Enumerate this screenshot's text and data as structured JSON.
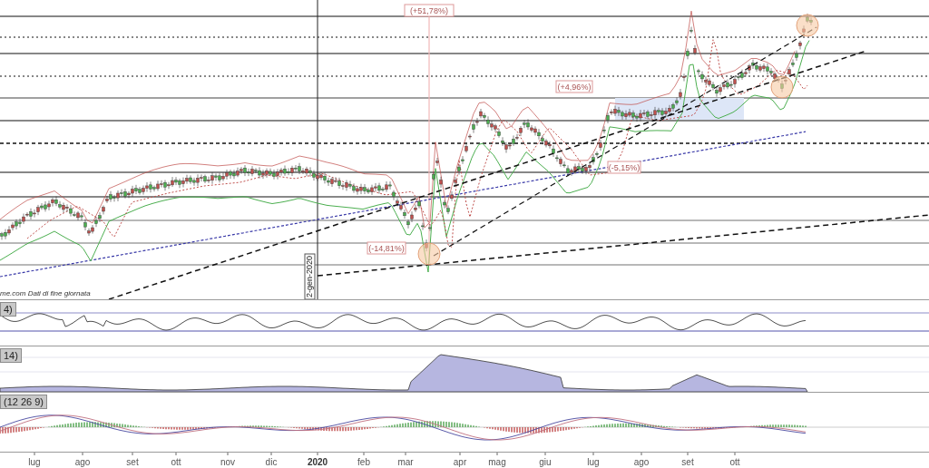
{
  "main_chart": {
    "annotations": [
      "(+51,78%)",
      "(+4,96%)",
      "(-5,15%)",
      "(-14,81%)"
    ],
    "date_marker": "2-gen-2020",
    "source_note": "me.com Dati di fine giornata"
  },
  "panels": [
    {
      "label": "4)",
      "kind": "oscillator"
    },
    {
      "label": "14)",
      "kind": "area"
    },
    {
      "label": "(12 26 9)",
      "kind": "histogram"
    }
  ],
  "x_axis": [
    {
      "text": "lug",
      "kind": "month"
    },
    {
      "text": "ago",
      "kind": "month"
    },
    {
      "text": "set",
      "kind": "month"
    },
    {
      "text": "ott",
      "kind": "month"
    },
    {
      "text": "nov",
      "kind": "month"
    },
    {
      "text": "dic",
      "kind": "month"
    },
    {
      "text": "2020",
      "kind": "year"
    },
    {
      "text": "feb",
      "kind": "month"
    },
    {
      "text": "mar",
      "kind": "month"
    },
    {
      "text": "apr",
      "kind": "month"
    },
    {
      "text": "mag",
      "kind": "month"
    },
    {
      "text": "giu",
      "kind": "month"
    },
    {
      "text": "lug",
      "kind": "month"
    },
    {
      "text": "ago",
      "kind": "month"
    },
    {
      "text": "set",
      "kind": "month"
    },
    {
      "text": "ott",
      "kind": "month"
    }
  ]
}
